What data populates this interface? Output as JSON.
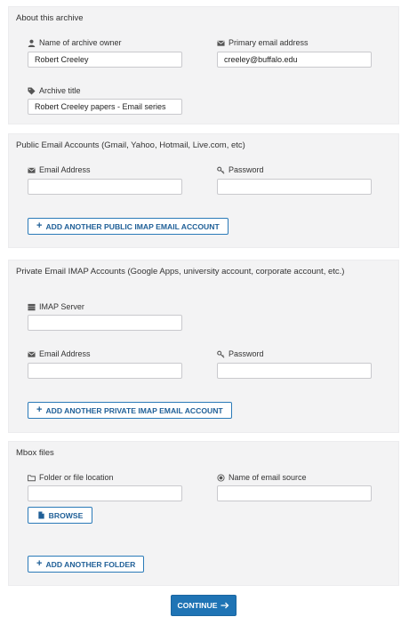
{
  "about": {
    "title": "About this archive",
    "owner_label": "Name of archive owner",
    "owner_value": "Robert Creeley",
    "email_label": "Primary email address",
    "email_value": "creeley@buffalo.edu",
    "archive_title_label": "Archive title",
    "archive_title_value": "Robert Creeley papers - Email series"
  },
  "public": {
    "title": "Public Email Accounts (Gmail, Yahoo, Hotmail, Live.com, etc)",
    "email_label": "Email Address",
    "password_label": "Password",
    "add_button": "ADD ANOTHER PUBLIC IMAP EMAIL ACCOUNT"
  },
  "private": {
    "title": "Private Email IMAP Accounts (Google Apps, university account, corporate account, etc.)",
    "server_label": "IMAP Server",
    "email_label": "Email Address",
    "password_label": "Password",
    "add_button": "ADD ANOTHER PRIVATE IMAP EMAIL ACCOUNT"
  },
  "mbox": {
    "title": "Mbox files",
    "folder_label": "Folder or file location",
    "source_label": "Name of email source",
    "browse_button": "BROWSE",
    "add_button": "ADD ANOTHER FOLDER"
  },
  "continue_label": "CONTINUE",
  "icons": {
    "user": "user-icon",
    "envelope": "envelope-icon",
    "tag": "tag-icon",
    "key": "key-icon",
    "server": "server-icon",
    "folder": "folder-icon",
    "record": "record-icon",
    "file": "file-icon",
    "arrow": "arrow-right-icon"
  },
  "colors": {
    "accent": "#1f74b5",
    "panel": "#f3f3f4"
  }
}
